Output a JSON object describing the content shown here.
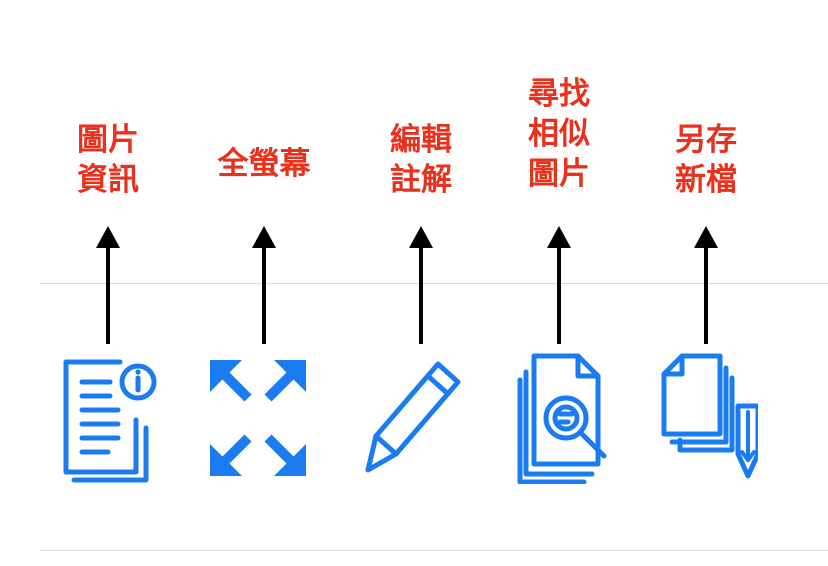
{
  "annotations": [
    {
      "lines": [
        "圖片",
        "資訊"
      ]
    },
    {
      "lines": [
        "全螢幕"
      ]
    },
    {
      "lines": [
        "編輯",
        "註解"
      ]
    },
    {
      "lines": [
        "尋找",
        "相似",
        "圖片"
      ]
    },
    {
      "lines": [
        "另存",
        "新檔"
      ]
    }
  ],
  "toolbar": {
    "icons": [
      "image-info-icon",
      "fullscreen-icon",
      "edit-annotation-icon",
      "find-similar-icon",
      "save-as-icon"
    ]
  },
  "colors": {
    "label": "#e8321e",
    "icon": "#1a7cf0",
    "arrow": "#000000",
    "divider": "#d9d9d9"
  }
}
